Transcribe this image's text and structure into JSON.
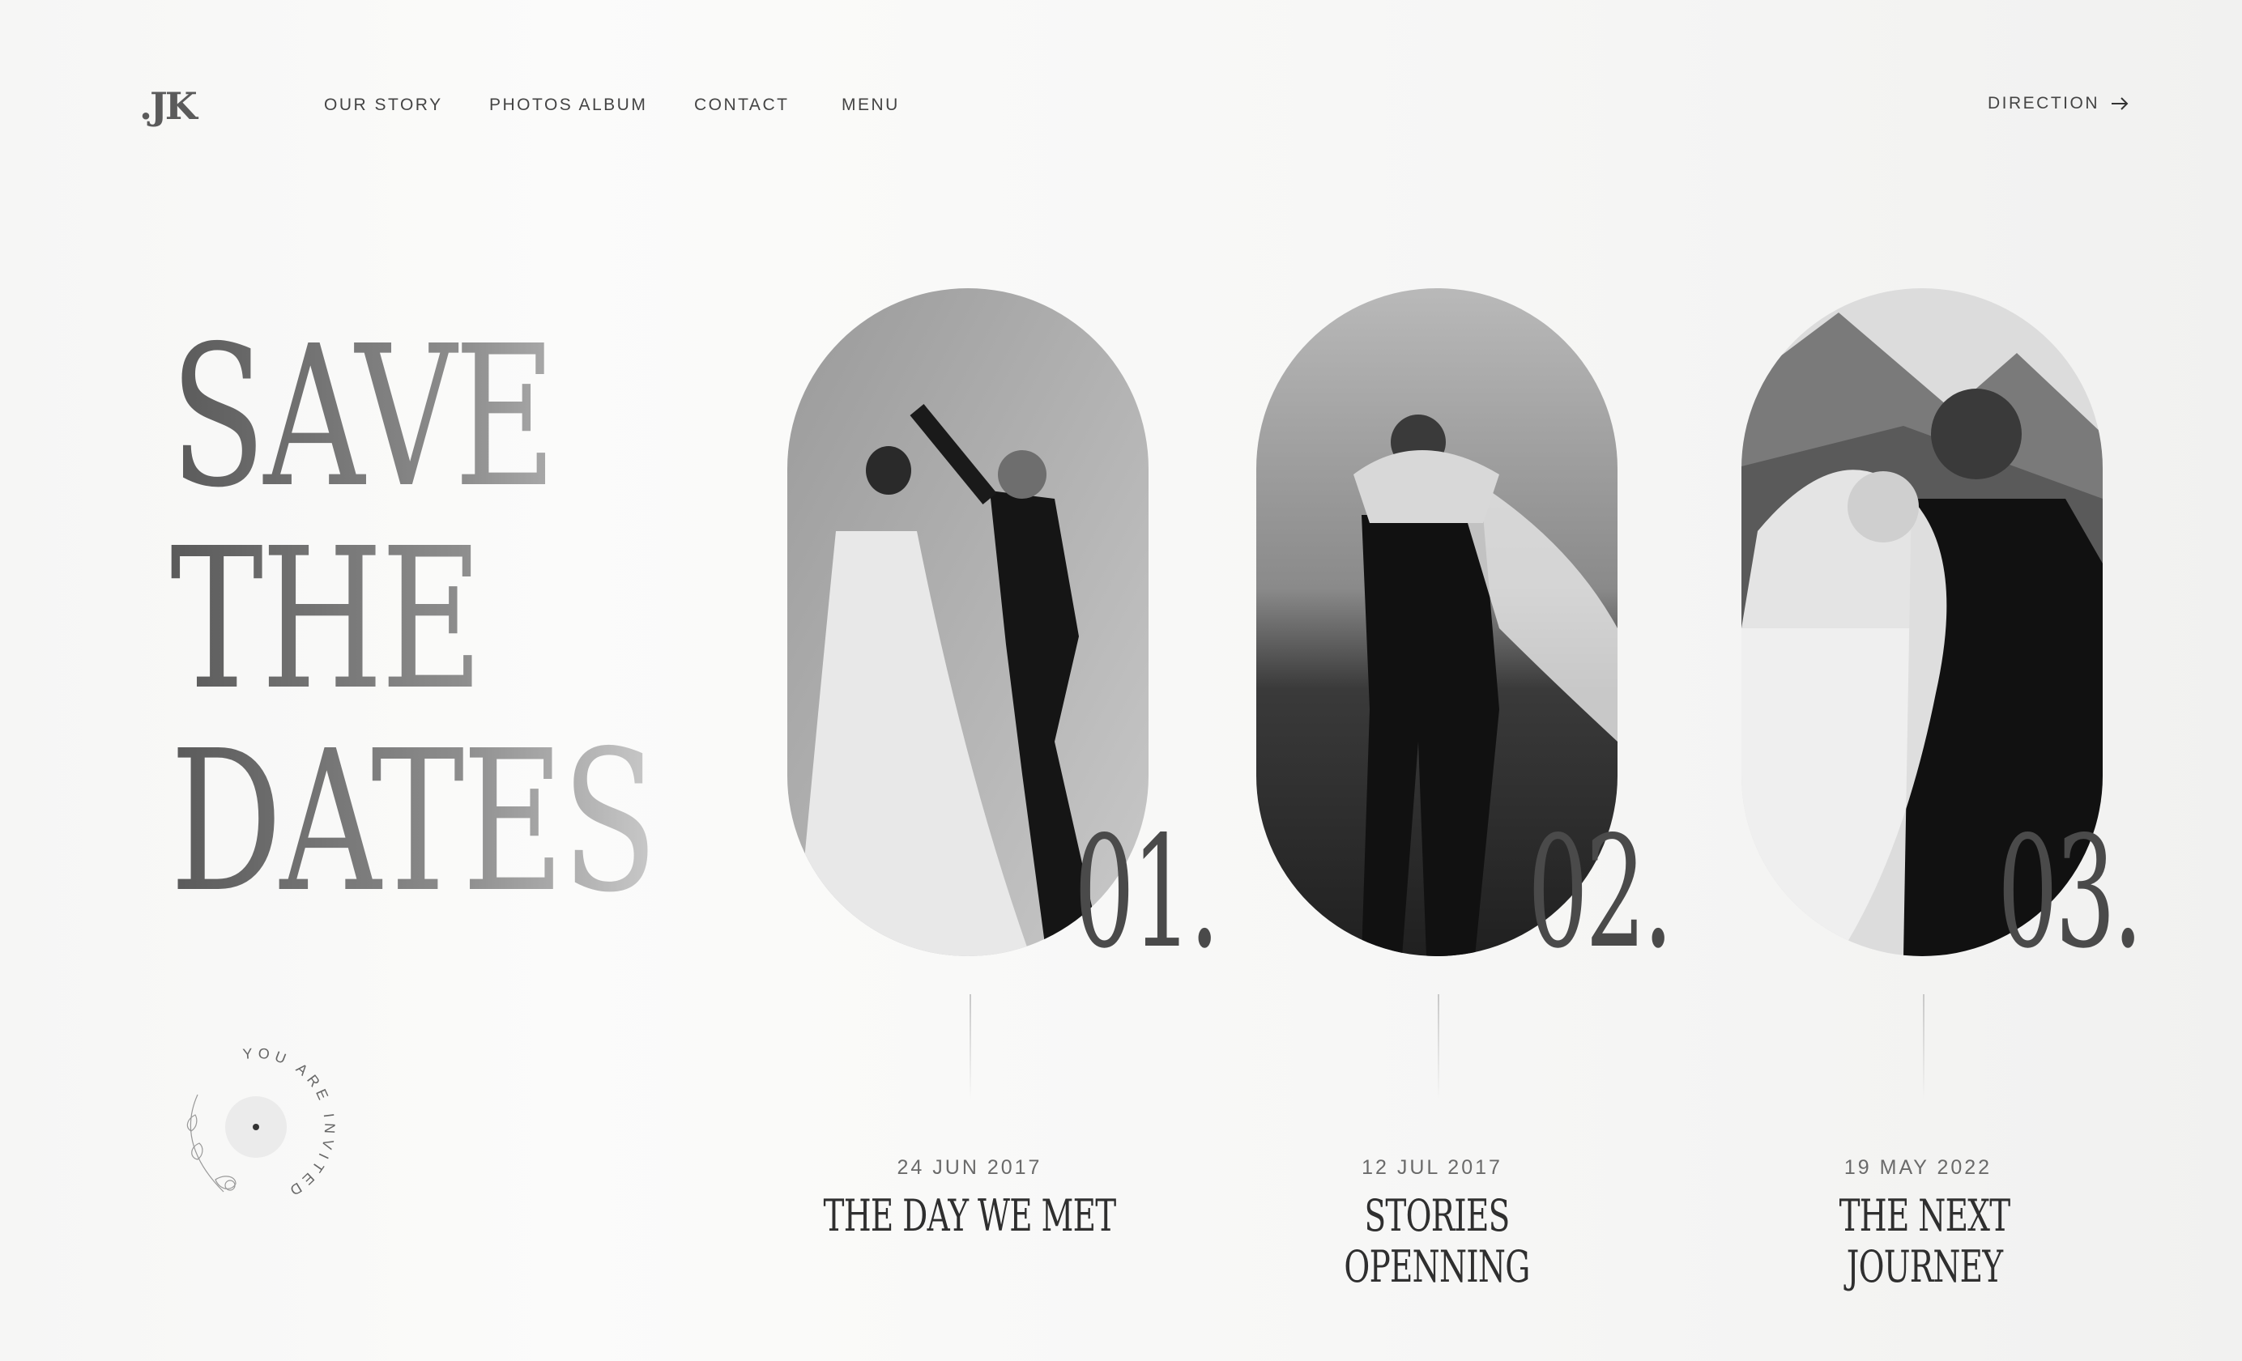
{
  "header": {
    "logo": ".JK",
    "nav": [
      "OUR STORY",
      "PHOTOS ALBUM",
      "CONTACT",
      "MENU"
    ],
    "direction_label": "DIRECTION"
  },
  "hero": {
    "headline": [
      "SAVE",
      "THE",
      "DATES"
    ]
  },
  "badge": {
    "text": "YOU ARE INVITED"
  },
  "timeline": [
    {
      "number": "01.",
      "date": "24 JUN 2017",
      "title": "THE DAY WE MET"
    },
    {
      "number": "02.",
      "date": "12 JUL 2017",
      "title": "STORIES OPENNING"
    },
    {
      "number": "03.",
      "date": "19 MAY 2022",
      "title": "THE NEXT JOURNEY"
    }
  ],
  "icons": {
    "direction": "arrow-right-icon",
    "badge": "floral-badge-icon"
  },
  "colors": {
    "background": "#f7f7f6",
    "text": "#3a3a3a",
    "muted": "#6a6a6a"
  }
}
